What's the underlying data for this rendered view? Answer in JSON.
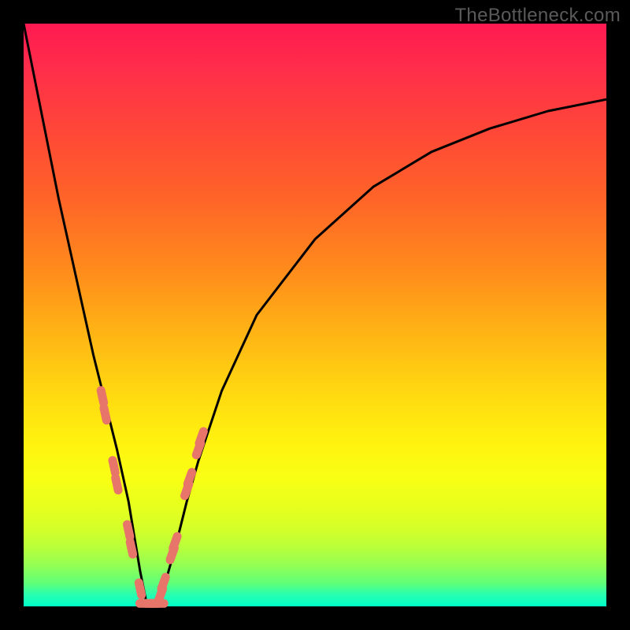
{
  "watermark": "TheBottleneck.com",
  "chart_data": {
    "type": "line",
    "title": "",
    "xlabel": "",
    "ylabel": "",
    "xlim": [
      0,
      100
    ],
    "ylim": [
      0,
      100
    ],
    "colors": {
      "curve": "#000000",
      "markers": "#e8756a",
      "gradient_top": "#ff1a51",
      "gradient_bottom": "#00ffc8"
    },
    "series": [
      {
        "name": "bottleneck-curve",
        "x": [
          0,
          2,
          4,
          6,
          8,
          10,
          12,
          14,
          16,
          18,
          19,
          20,
          21,
          22,
          24,
          26,
          28,
          30,
          34,
          40,
          50,
          60,
          70,
          80,
          90,
          100
        ],
        "y": [
          100,
          90,
          80,
          70,
          61,
          52,
          43,
          35,
          27,
          18,
          12,
          6,
          1,
          0,
          3,
          10,
          18,
          25,
          37,
          50,
          63,
          72,
          78,
          82,
          85,
          87
        ]
      }
    ],
    "markers": {
      "left_branch": [
        {
          "x": 13.5,
          "y": 36
        },
        {
          "x": 14.0,
          "y": 33
        },
        {
          "x": 15.5,
          "y": 24
        },
        {
          "x": 16.0,
          "y": 21
        },
        {
          "x": 18.0,
          "y": 13
        },
        {
          "x": 18.5,
          "y": 10
        },
        {
          "x": 20.0,
          "y": 3
        }
      ],
      "right_branch": [
        {
          "x": 23.5,
          "y": 2
        },
        {
          "x": 24.0,
          "y": 4
        },
        {
          "x": 25.5,
          "y": 9
        },
        {
          "x": 26.0,
          "y": 11
        },
        {
          "x": 28.0,
          "y": 20
        },
        {
          "x": 28.5,
          "y": 22
        },
        {
          "x": 30.0,
          "y": 27
        },
        {
          "x": 30.5,
          "y": 29
        }
      ],
      "bottom": [
        {
          "x": 21.0,
          "y": 0.5
        },
        {
          "x": 22.0,
          "y": 0.5
        },
        {
          "x": 23.0,
          "y": 0.5
        }
      ]
    },
    "annotations": []
  }
}
